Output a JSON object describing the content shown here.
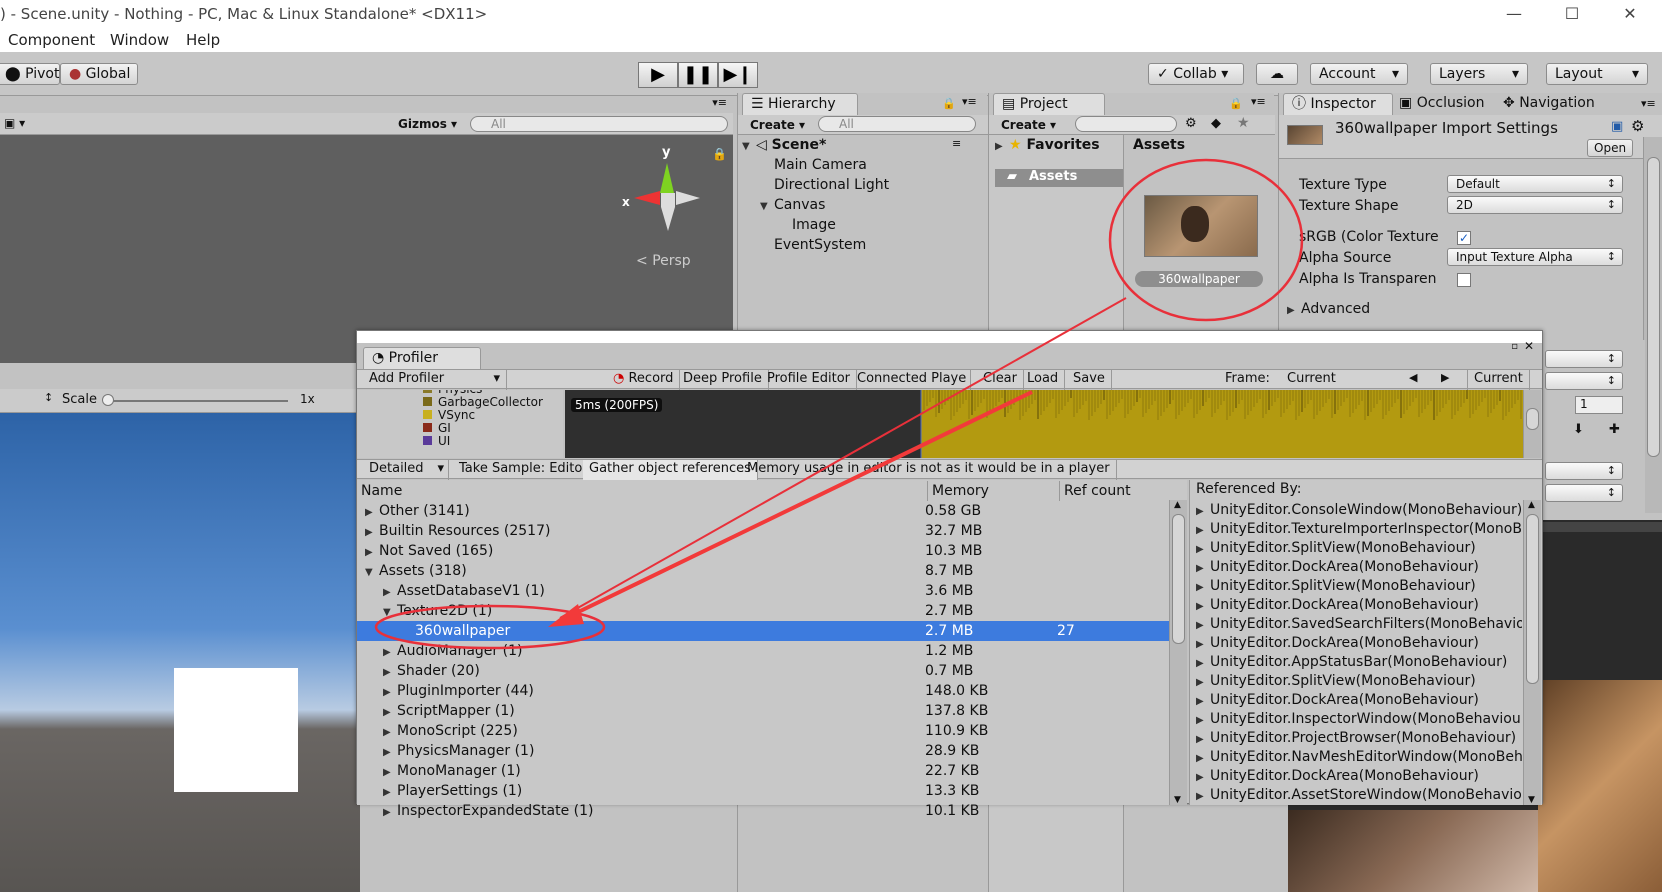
{
  "window": {
    "title": ") - Scene.unity - Nothing - PC, Mac & Linux Standalone* <DX11>",
    "controls": [
      "—",
      "☐",
      "✕"
    ]
  },
  "menu": [
    "Component",
    "Window",
    "Help"
  ],
  "toolbar": {
    "pivot": "Pivot",
    "global": "Global",
    "collab": "Collab ▾",
    "account": "Account",
    "layers": "Layers",
    "layout": "Layout"
  },
  "scene": {
    "gizmos": "Gizmos",
    "search_placeholder": "All",
    "axis_y": "y",
    "axis_x": "x",
    "persp": "Persp"
  },
  "game": {
    "scale_label": "Scale",
    "scale_value": "1x"
  },
  "hierarchy": {
    "tab": "Hierarchy",
    "create": "Create",
    "search_placeholder": "All",
    "scene": "Scene*",
    "items": [
      "Main Camera",
      "Directional Light",
      "Canvas",
      "Image",
      "EventSystem"
    ]
  },
  "project": {
    "tab": "Project",
    "create": "Create",
    "favorites": "Favorites",
    "assets_header": "Assets",
    "assets_folder": "Assets",
    "asset_name": "360wallpaper"
  },
  "inspector": {
    "tabs": [
      "Inspector",
      "Occlusion",
      "Navigation"
    ],
    "title": "360wallpaper Import Settings",
    "open": "Open",
    "fields": [
      {
        "label": "Texture Type",
        "value": "Default"
      },
      {
        "label": "Texture Shape",
        "value": "2D"
      },
      {
        "label": "sRGB (Color Texture",
        "value": true
      },
      {
        "label": "Alpha Source",
        "value": "Input Texture Alpha"
      },
      {
        "label": "Alpha Is Transparen",
        "value": false
      }
    ],
    "advanced": "Advanced",
    "side_value": "1"
  },
  "profiler": {
    "tab": "Profiler",
    "add_profiler": "Add Profiler",
    "record": "Record",
    "deep_profile": "Deep Profile",
    "profile_editor": "Profile Editor",
    "connected": "Connected Playe ▾",
    "clear": "Clear",
    "load": "Load",
    "save": "Save",
    "frame_label": "Frame:",
    "frame_value": "Current",
    "current_btn": "Current",
    "fps_label": "5ms (200FPS)",
    "legend": [
      {
        "name": "Physics",
        "color": "#8a7a2a"
      },
      {
        "name": "GarbageCollector",
        "color": "#7a6a1a"
      },
      {
        "name": "VSync",
        "color": "#c8b020"
      },
      {
        "name": "GI",
        "color": "#8a2a1a"
      },
      {
        "name": "UI",
        "color": "#5a3a9a"
      }
    ],
    "detailed": "Detailed",
    "take_sample": "Take Sample: Editor",
    "gather": "Gather object references",
    "memory_note": "Memory usage in editor is not as it would be in a player",
    "headers": {
      "name": "Name",
      "memory": "Memory",
      "ref": "Ref count",
      "referenced": "Referenced By:"
    },
    "rows": [
      {
        "name": "Other (3141)",
        "memory": "0.58 GB",
        "ref": "",
        "indent": 0,
        "tri": "▶"
      },
      {
        "name": "Builtin Resources (2517)",
        "memory": "32.7 MB",
        "ref": "",
        "indent": 0,
        "tri": "▶"
      },
      {
        "name": "Not Saved (165)",
        "memory": "10.3 MB",
        "ref": "",
        "indent": 0,
        "tri": "▶"
      },
      {
        "name": "Assets (318)",
        "memory": "8.7 MB",
        "ref": "",
        "indent": 0,
        "tri": "▼"
      },
      {
        "name": "AssetDatabaseV1 (1)",
        "memory": "3.6 MB",
        "ref": "",
        "indent": 1,
        "tri": "▶"
      },
      {
        "name": "Texture2D (1)",
        "memory": "2.7 MB",
        "ref": "",
        "indent": 1,
        "tri": "▼"
      },
      {
        "name": "360wallpaper",
        "memory": "2.7 MB",
        "ref": "27",
        "indent": 2,
        "tri": "",
        "selected": true
      },
      {
        "name": "AudioManager (1)",
        "memory": "1.2 MB",
        "ref": "",
        "indent": 1,
        "tri": "▶"
      },
      {
        "name": "Shader (20)",
        "memory": "0.7 MB",
        "ref": "",
        "indent": 1,
        "tri": "▶"
      },
      {
        "name": "PluginImporter (44)",
        "memory": "148.0 KB",
        "ref": "",
        "indent": 1,
        "tri": "▶"
      },
      {
        "name": "ScriptMapper (1)",
        "memory": "137.8 KB",
        "ref": "",
        "indent": 1,
        "tri": "▶"
      },
      {
        "name": "MonoScript (225)",
        "memory": "110.9 KB",
        "ref": "",
        "indent": 1,
        "tri": "▶"
      },
      {
        "name": "PhysicsManager (1)",
        "memory": "28.9 KB",
        "ref": "",
        "indent": 1,
        "tri": "▶"
      },
      {
        "name": "MonoManager (1)",
        "memory": "22.7 KB",
        "ref": "",
        "indent": 1,
        "tri": "▶"
      },
      {
        "name": "PlayerSettings (1)",
        "memory": "13.3 KB",
        "ref": "",
        "indent": 1,
        "tri": "▶"
      },
      {
        "name": "InspectorExpandedState (1)",
        "memory": "10.1 KB",
        "ref": "",
        "indent": 1,
        "tri": "▶"
      }
    ],
    "referenced_by": [
      "UnityEditor.ConsoleWindow(MonoBehaviour)",
      "UnityEditor.TextureImporterInspector(MonoBehaviour)",
      "UnityEditor.SplitView(MonoBehaviour)",
      "UnityEditor.DockArea(MonoBehaviour)",
      "UnityEditor.SplitView(MonoBehaviour)",
      "UnityEditor.DockArea(MonoBehaviour)",
      "UnityEditor.SavedSearchFilters(MonoBehaviour)",
      "UnityEditor.DockArea(MonoBehaviour)",
      "UnityEditor.AppStatusBar(MonoBehaviour)",
      "UnityEditor.SplitView(MonoBehaviour)",
      "UnityEditor.DockArea(MonoBehaviour)",
      "UnityEditor.InspectorWindow(MonoBehaviour)",
      "UnityEditor.ProjectBrowser(MonoBehaviour)",
      "UnityEditor.NavMeshEditorWindow(MonoBehaviour)",
      "UnityEditor.DockArea(MonoBehaviour)",
      "UnityEditor.AssetStoreWindow(MonoBehaviour)"
    ]
  },
  "colors": {
    "selection": "#3d7bde",
    "annotation": "#e8303a",
    "graph": "#b39a10"
  }
}
